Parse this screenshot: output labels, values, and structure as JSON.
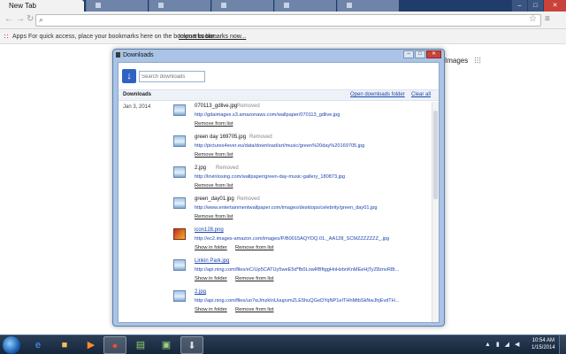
{
  "browser": {
    "tabs": [
      {
        "label": "New Tab",
        "active": true
      },
      {
        "label": "",
        "active": false
      },
      {
        "label": "",
        "active": false
      },
      {
        "label": "",
        "active": false
      },
      {
        "label": "",
        "active": false
      },
      {
        "label": "",
        "active": false
      }
    ],
    "window_controls": {
      "minimize": "–",
      "maximize": "□",
      "close": "✕"
    },
    "omnibox_value": "",
    "bookmarks_bar": {
      "apps_label": "Apps",
      "message": "For quick access, place your bookmarks here on the bookmarks bar.",
      "import_link": "Import bookmarks now..."
    },
    "images_link": "Images"
  },
  "downloads_window": {
    "title": "Downloads",
    "search_placeholder": "Search downloads",
    "section_label": "Downloads",
    "open_folder_link": "Open downloads folder",
    "clear_all_link": "Clear all",
    "date": "Jan 3, 2014",
    "items": [
      {
        "name": "070113_gdlive.jpg",
        "status": "Removed",
        "url": "http://gdaimages.s3.amazonaws.com/wallpaper/070113_gdlive.jpg",
        "actions": [
          "Remove from list"
        ],
        "icon": "image-file-icon"
      },
      {
        "name": "green day 169705.jpg",
        "status": "Removed",
        "url": "http://pictures4ever.eu/data/download/art/music/green%20day%20169705.jpg",
        "actions": [
          "Remove from list"
        ],
        "icon": "image-file-icon"
      },
      {
        "name": "2.jpg",
        "status": "Removed",
        "url": "http://lovinlosing.com/wallpaper/green-day-music-gallery_180873.jpg",
        "actions": [
          "Remove from list"
        ],
        "icon": "image-file-icon"
      },
      {
        "name": "green_day01.jpg",
        "status": "Removed",
        "url": "http://www.entertainmentwallpaper.com/images/desktops/celebrity/green_day01.jpg",
        "actions": [
          "Remove from list"
        ],
        "icon": "image-file-icon"
      },
      {
        "name": "icon128.png",
        "status": "",
        "url": "http://ec2.images-amazon.com/images/P/B0015AQYDQ.01._AA128_SCMZZZZZZZ_.jpg",
        "actions": [
          "Show in folder",
          "Remove from list"
        ],
        "icon": "png-file-icon"
      },
      {
        "name": "Linkin Park.jpg",
        "status": "",
        "url": "http://api.ning.com/files/eC/Up5CATUy5weE5d*fb0LowRBftggHnHzbnKnMEeHjTyZ8znvR8t...",
        "actions": [
          "Show in folder",
          "Remove from list"
        ],
        "icon": "image-file-icon"
      },
      {
        "name": "2.jpg",
        "status": "",
        "url": "http://api.ning.com/files/uo7wJmzkInUuupvmZLE5huQGeDYqNP1eITHhMtbSkNwJhjEvdTH...",
        "actions": [
          "Show in folder",
          "Remove from list"
        ],
        "icon": "image-file-icon"
      }
    ]
  },
  "taskbar": {
    "clock_time": "10:54 AM",
    "clock_date": "1/15/2014"
  }
}
